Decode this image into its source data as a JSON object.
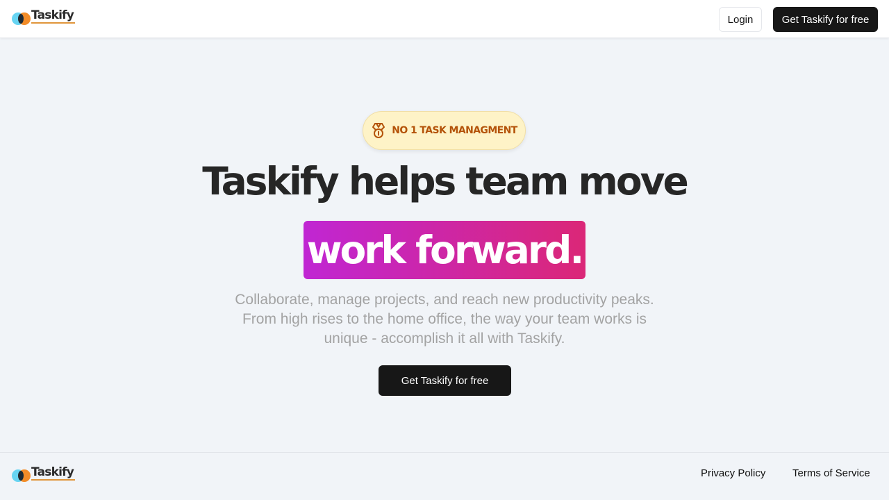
{
  "brand": {
    "name": "Taskify",
    "colors": {
      "cyan": "#67d4f2",
      "orange": "#f28c28",
      "underline": "#e0953a"
    }
  },
  "nav": {
    "login_label": "Login",
    "cta_label": "Get Taskify for free"
  },
  "hero": {
    "badge": {
      "icon": "medal-icon",
      "text": "No 1 task managment"
    },
    "headline": "Taskify helps team move",
    "highlight": "work forward.",
    "subtext_lines": [
      "Collaborate, manage projects, and reach new productivity peaks.",
      "From high rises to the home office, the way your team works is",
      "unique - accomplish it all with Taskify."
    ],
    "cta_label": "Get Taskify for free",
    "colors": {
      "gradient_start": "#c026d3",
      "gradient_end": "#db2777",
      "badge_bg": "#fef3c7",
      "badge_text": "#b45309"
    }
  },
  "footer": {
    "privacy_label": "Privacy Policy",
    "terms_label": "Terms of Service"
  }
}
